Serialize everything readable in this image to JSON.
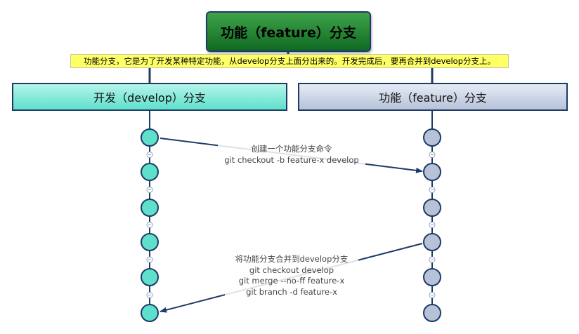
{
  "title": "功能（feature）分支",
  "description": "功能分支，它是为了开发某种特定功能，从develop分支上面分出来的。开发完成后，要再合并到develop分支上。",
  "branches": {
    "develop": "开发（develop）分支",
    "feature": "功能（feature）分支"
  },
  "notes": {
    "create": [
      "创建一个功能分支命令",
      "git checkout -b feature-x develop"
    ],
    "merge": [
      "将功能分支合并到develop分支",
      "git checkout develop",
      "git merge --no-ff feature-x",
      "git branch -d feature-x"
    ]
  },
  "colors": {
    "develop_node": "#5fe0cc",
    "feature_node": "#b7c2d9",
    "line": "#1d3b66",
    "title_bg": "#2a8a38",
    "highlight": "#ffff66"
  }
}
